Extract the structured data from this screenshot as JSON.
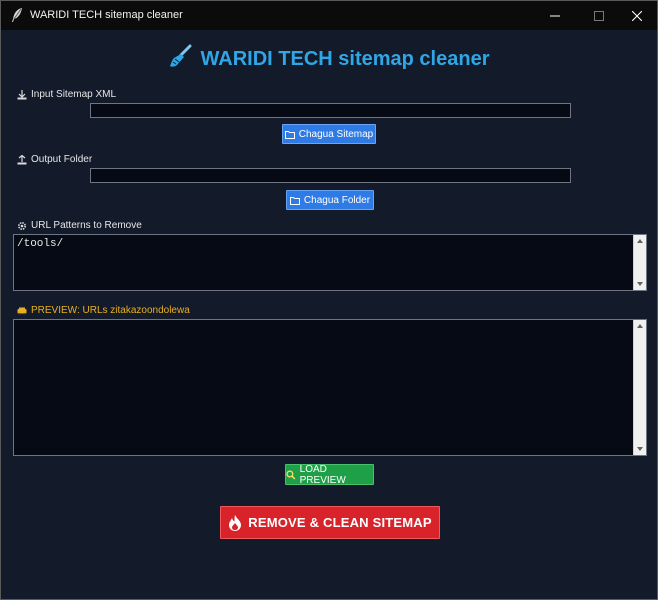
{
  "window": {
    "title": "WARIDI TECH sitemap cleaner",
    "minimize_glyph": "─",
    "maximize_glyph": "☐",
    "close_glyph": "✕"
  },
  "heading": {
    "title": "WARIDI TECH sitemap cleaner",
    "color": "#2fa6e6",
    "icon": "broom-icon"
  },
  "input_sitemap": {
    "label": "Input Sitemap XML",
    "value": "",
    "button_label": "Chagua Sitemap",
    "label_icon": "download-icon",
    "button_icon": "folder-icon"
  },
  "output_folder": {
    "label": "Output Folder",
    "value": "",
    "button_label": "Chagua Folder",
    "label_icon": "upload-icon",
    "button_icon": "folder-icon"
  },
  "patterns": {
    "label": "URL Patterns to Remove",
    "value": "/tools/",
    "label_icon": "gear-icon"
  },
  "preview": {
    "label": "PREVIEW: URLs zitakazoondolewa",
    "value": "",
    "label_color": "#e8b020",
    "label_icon": "car-icon"
  },
  "actions": {
    "load_preview_label": "LOAD PREVIEW",
    "load_preview_icon": "magnifier-icon",
    "remove_clean_label": "REMOVE & CLEAN SITEMAP",
    "remove_clean_icon": "fire-icon"
  }
}
